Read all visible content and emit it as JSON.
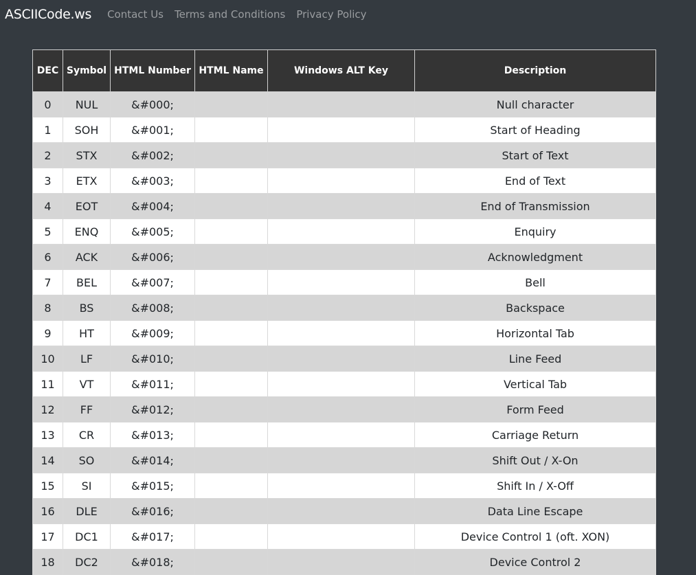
{
  "navbar": {
    "brand": "ASCIICode.ws",
    "links": [
      "Contact Us",
      "Terms and Conditions",
      "Privacy Policy"
    ]
  },
  "table": {
    "headers": [
      "DEC",
      "Symbol",
      "HTML Number",
      "HTML Name",
      "Windows ALT Key",
      "Description"
    ],
    "rows": [
      [
        "0",
        "NUL",
        "&#000;",
        "",
        "",
        "Null character"
      ],
      [
        "1",
        "SOH",
        "&#001;",
        "",
        "",
        "Start of Heading"
      ],
      [
        "2",
        "STX",
        "&#002;",
        "",
        "",
        "Start of Text"
      ],
      [
        "3",
        "ETX",
        "&#003;",
        "",
        "",
        "End of Text"
      ],
      [
        "4",
        "EOT",
        "&#004;",
        "",
        "",
        "End of Transmission"
      ],
      [
        "5",
        "ENQ",
        "&#005;",
        "",
        "",
        "Enquiry"
      ],
      [
        "6",
        "ACK",
        "&#006;",
        "",
        "",
        "Acknowledgment"
      ],
      [
        "7",
        "BEL",
        "&#007;",
        "",
        "",
        "Bell"
      ],
      [
        "8",
        "BS",
        "&#008;",
        "",
        "",
        "Backspace"
      ],
      [
        "9",
        "HT",
        "&#009;",
        "",
        "",
        "Horizontal Tab"
      ],
      [
        "10",
        "LF",
        "&#010;",
        "",
        "",
        "Line Feed"
      ],
      [
        "11",
        "VT",
        "&#011;",
        "",
        "",
        "Vertical Tab"
      ],
      [
        "12",
        "FF",
        "&#012;",
        "",
        "",
        "Form Feed"
      ],
      [
        "13",
        "CR",
        "&#013;",
        "",
        "",
        "Carriage Return"
      ],
      [
        "14",
        "SO",
        "&#014;",
        "",
        "",
        "Shift Out / X-On"
      ],
      [
        "15",
        "SI",
        "&#015;",
        "",
        "",
        "Shift In / X-Off"
      ],
      [
        "16",
        "DLE",
        "&#016;",
        "",
        "",
        "Data Line Escape"
      ],
      [
        "17",
        "DC1",
        "&#017;",
        "",
        "",
        "Device Control 1 (oft. XON)"
      ],
      [
        "18",
        "DC2",
        "&#018;",
        "",
        "",
        "Device Control 2"
      ]
    ]
  }
}
